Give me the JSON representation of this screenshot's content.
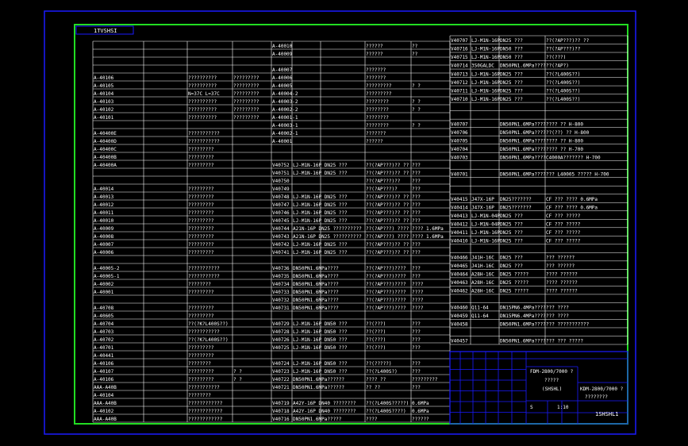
{
  "drawing": {
    "tag_top_left": "1TVSHSI",
    "tag_bottom_right": "1SHSHL1"
  },
  "title_block": {
    "line1": "FDM-2800/7000 ?",
    "line2": "?????",
    "line3": "(SHSHL)",
    "right1": "KDM-2800/7000 ?",
    "right2": "????????",
    "scale": "1:10",
    "sheet": "S"
  },
  "left_table": {
    "rows": [
      {
        "a": "",
        "b": "",
        "c": "",
        "d": "A-40010",
        "e": "",
        "f": "??????",
        "g": "??"
      },
      {
        "a": "",
        "b": "",
        "c": "",
        "d": "A-40009",
        "e": "",
        "f": "??????",
        "g": "??"
      },
      {
        "a": "",
        "b": "",
        "c": "",
        "d": "",
        "e": "",
        "f": "",
        "g": ""
      },
      {
        "a": "",
        "b": "",
        "c": "",
        "d": "A-40007",
        "e": "",
        "f": "???????",
        "g": ""
      },
      {
        "a": "A-40106",
        "b": "??????????",
        "c": "?????????",
        "d": "A-40006",
        "e": "",
        "f": "???????",
        "g": ""
      },
      {
        "a": "A-40105",
        "b": "??????????",
        "c": "?????????",
        "d": "A-40005",
        "e": "",
        "f": "?????????",
        "g": "?  ?"
      },
      {
        "a": "A-40104",
        "b": "N=37C  L=37C",
        "c": "?????????",
        "d": "A-40004-2",
        "e": "",
        "f": "?????????",
        "g": ""
      },
      {
        "a": "A-40103",
        "b": "??????????",
        "c": "?????????",
        "d": "A-40003-2",
        "e": "",
        "f": "????????",
        "g": "?  ?"
      },
      {
        "a": "A-40102",
        "b": "??????????",
        "c": "?????????",
        "d": "A-40002-2",
        "e": "",
        "f": "????????",
        "g": "?  ?"
      },
      {
        "a": "A-40101",
        "b": "??????????",
        "c": "?????????",
        "d": "A-40001-1",
        "e": "",
        "f": "????????",
        "g": ""
      },
      {
        "a": "",
        "b": "",
        "c": "",
        "d": "A-40003-1",
        "e": "",
        "f": "????????",
        "g": "?  ?"
      },
      {
        "a": "A-40400E",
        "b": "???????????",
        "c": "",
        "d": "A-40002-1",
        "e": "",
        "f": "???????",
        "g": ""
      },
      {
        "a": "A-40400D",
        "b": "???????????",
        "c": "",
        "d": "A-40001",
        "e": "",
        "f": "??????",
        "g": ""
      },
      {
        "a": "A-40400C",
        "b": "?????????",
        "c": "",
        "d": "",
        "e": "",
        "f": "",
        "g": ""
      },
      {
        "a": "A-40400B",
        "b": "?????????",
        "c": "",
        "d": "",
        "e": "",
        "f": "",
        "g": ""
      },
      {
        "a": "A-40400A",
        "b": "?????????",
        "c": "",
        "d": "V40752",
        "e": "LJ-M1N-16P  DN25 ???",
        "f": "??(?AP???)?? ??",
        "g": "???"
      },
      {
        "a": "",
        "b": "",
        "c": "",
        "d": "V40751",
        "e": "LJ-M1N-16P  DN25 ???",
        "f": "??(?AP???)?? ??",
        "g": "???"
      },
      {
        "a": "",
        "b": "",
        "c": "",
        "d": "V40750",
        "e": "",
        "f": "??(?AP???)??",
        "g": "???"
      },
      {
        "a": "A-40014",
        "b": "?????????",
        "c": "",
        "d": "V40749",
        "e": "",
        "f": "??(?AP???)?",
        "g": "???"
      },
      {
        "a": "A-40013",
        "b": "?????????",
        "c": "",
        "d": "V40748",
        "e": "LJ-M1N-16P  DN25 ???",
        "f": "??(?AP???)?? ??",
        "g": "???"
      },
      {
        "a": "A-40012",
        "b": "?????????",
        "c": "",
        "d": "V40747",
        "e": "LJ-M1N-16P  DN25 ???",
        "f": "??(?AP???)?? ??",
        "g": "???"
      },
      {
        "a": "A-40011",
        "b": "?????????",
        "c": "",
        "d": "V40746",
        "e": "LJ-M1N-16P  DN25 ???",
        "f": "??(?AP???)?? ??",
        "g": "???"
      },
      {
        "a": "A-40010",
        "b": "?????????",
        "c": "",
        "d": "V40745",
        "e": "LJ-M1N-16P  DN25 ???",
        "f": "??(?AP???)?? ??",
        "g": "???"
      },
      {
        "a": "A-40009",
        "b": "?????????",
        "c": "",
        "d": "V40744",
        "e": "A21N-16P  DN25 ??????????",
        "f": "??(?AP???) ????",
        "g": "????  1.6MPa"
      },
      {
        "a": "A-40008",
        "b": "?????????",
        "c": "",
        "d": "V40743",
        "e": "A21N-16P  DN25 ??????????",
        "f": "??(?AP???) ????",
        "g": "????  1.6MPa"
      },
      {
        "a": "A-40007",
        "b": "?????????",
        "c": "",
        "d": "V40742",
        "e": "LJ-M1N-16P  DN25 ???",
        "f": "??(?AP???)?? ??",
        "g": "???"
      },
      {
        "a": "A-40006",
        "b": "?????????",
        "c": "",
        "d": "V40741",
        "e": "LJ-M1N-16P  DN25 ???",
        "f": "??(?AP???)?? ??",
        "g": "???"
      },
      {
        "a": "",
        "b": "",
        "c": "",
        "d": "",
        "e": "",
        "f": "",
        "g": ""
      },
      {
        "a": "A-40005-2",
        "b": "???????????",
        "c": "",
        "d": "V40736",
        "e": "DN50PN1.6MPa????",
        "f": "??(?AP???)????",
        "g": "???"
      },
      {
        "a": "A-40005-1",
        "b": "???????????",
        "c": "",
        "d": "V40735",
        "e": "DN50PN1.6MPa????",
        "f": "??(?AP???)????",
        "g": "???"
      },
      {
        "a": "A-40002",
        "b": "????????",
        "c": "",
        "d": "V40734",
        "e": "DN50PN1.6MPa????",
        "f": "??(?AP???)????",
        "g": "????"
      },
      {
        "a": "A-40001",
        "b": "?????????",
        "c": "",
        "d": "V40733",
        "e": "DN50PN1.6MPa????",
        "f": "??(?AP???)????",
        "g": "????"
      },
      {
        "a": "",
        "b": "",
        "c": "",
        "d": "V40732",
        "e": "DN50PN1.6MPa????",
        "f": "??(?AP???)????",
        "g": "????"
      },
      {
        "a": "A-40708",
        "b": "?????????",
        "c": "",
        "d": "V40731",
        "e": "DN50PN1.6MPa????",
        "f": "??(?AP???)????",
        "g": "????"
      },
      {
        "a": "A-40605",
        "b": "?????????",
        "c": "",
        "d": "",
        "e": "",
        "f": "",
        "g": ""
      },
      {
        "a": "A-40704",
        "b": "??(?K?L400S??)",
        "c": "",
        "d": "V40729",
        "e": "LJ-M1N-16P  DN50 ???",
        "f": "??(???)",
        "g": "???"
      },
      {
        "a": "A-40703",
        "b": "???????????",
        "c": "",
        "d": "V40728",
        "e": "LJ-M1N-16P  DN50 ???",
        "f": "??(???)",
        "g": "???"
      },
      {
        "a": "A-40702",
        "b": "??(?K?L400S??)",
        "c": "",
        "d": "V40726",
        "e": "LJ-M1N-16P  DN50 ???",
        "f": "??(???)",
        "g": "???"
      },
      {
        "a": "A-40701",
        "b": "?????????",
        "c": "",
        "d": "V40725",
        "e": "LJ-M1N-16P  DN50 ???",
        "f": "??(???)",
        "g": "???"
      },
      {
        "a": "A-40441",
        "b": "?????????",
        "c": "",
        "d": "",
        "e": "",
        "f": "",
        "g": ""
      },
      {
        "a": "A-40106",
        "b": "????????",
        "c": "",
        "d": "V40724",
        "e": "LJ-M1N-16P  DN50 ???",
        "f": "??(?????)",
        "g": "???"
      },
      {
        "a": "A-40107",
        "b": "?????????",
        "c": "?  ?",
        "d": "V40723",
        "e": "LJ-M1N-16P  DN50 ???",
        "f": "??(?L400S?)",
        "g": "???"
      },
      {
        "a": "A-40106",
        "b": "?????????",
        "c": "?  ?",
        "d": "V40722",
        "e": "DN50PN1.6MPa??????",
        "f": "???? ??",
        "g": "?????????"
      },
      {
        "a": "AAA-A40B",
        "b": "???????????",
        "c": "",
        "d": "V40721",
        "e": "DN50PN1.6MPa??????",
        "f": "?? ??",
        "g": "???"
      },
      {
        "a": "A-40104",
        "b": "????????",
        "c": "",
        "d": "",
        "e": "",
        "f": "",
        "g": ""
      },
      {
        "a": "AAA-A40B",
        "b": "????????????",
        "c": "",
        "d": "V40719",
        "e": "A42Y-16P  DN40 ????????",
        "f": "??(?L400S?????)",
        "g": "0.6MPa"
      },
      {
        "a": "A-40102",
        "b": "????????????",
        "c": "",
        "d": "V40718",
        "e": "A42Y-16P  DN40 ????????",
        "f": "??(?L400S????)",
        "g": "0.6MPa"
      },
      {
        "a": "AAA-A40B",
        "b": "????????????",
        "c": "",
        "d": "V40716",
        "e": "DN50PN1.6MPa?????",
        "f": "????",
        "g": "??????"
      }
    ]
  },
  "right_table": {
    "rows": [
      {
        "a": "V40707",
        "b": "LJ-M1N-16P",
        "c": "DN25 ???",
        "d": "??(?AP???)?? ??"
      },
      {
        "a": "V40716",
        "b": "LJ-M1N-16P",
        "c": "DN50 ???",
        "d": "??(?AP???)??"
      },
      {
        "a": "V40715",
        "b": "LJ-M1N-16P",
        "c": "DN50 ???",
        "d": "??(???)"
      },
      {
        "a": "V40714",
        "b": "3S0GALDC",
        "c": "DN50PN1.6MPa????",
        "d": "??(?AP?)"
      },
      {
        "a": "V40713",
        "b": "LJ-M1N-16P",
        "c": "DN25 ???",
        "d": "??(?L400S??)"
      },
      {
        "a": "V40712",
        "b": "LJ-M1N-16P",
        "c": "DN25 ???",
        "d": "??(?L400S??)"
      },
      {
        "a": "V40711",
        "b": "LJ-M1N-16P",
        "c": "DN25 ???",
        "d": "??(?L400S??)"
      },
      {
        "a": "V40710",
        "b": "LJ-M1N-16P",
        "c": "DN25 ???",
        "d": "??(?L400S??)"
      },
      {
        "a": "",
        "b": "",
        "c": "",
        "d": ""
      },
      {
        "a": "",
        "b": "",
        "c": "",
        "d": ""
      },
      {
        "a": "V40707",
        "b": "",
        "c": "DN50PN1.6MPa????",
        "d": "????  ??  H-800"
      },
      {
        "a": "V40706",
        "b": "",
        "c": "DN50PN1.6MPa????",
        "d": "??(??)  ??  H-800"
      },
      {
        "a": "V40705",
        "b": "",
        "c": "DN50PN1.6MPa????",
        "d": "????  ??  H-800"
      },
      {
        "a": "V40704",
        "b": "",
        "c": "DN50PN1.6MPa????",
        "d": "????  ??  H-700"
      },
      {
        "a": "V40703",
        "b": "",
        "c": "DN50PN1.6MPa????",
        "d": "C4000A???????  H-700"
      },
      {
        "a": "",
        "b": "",
        "c": "",
        "d": ""
      },
      {
        "a": "V40701",
        "b": "",
        "c": "DN50PN1.6MPa????",
        "d": "??? L40005  ?????  H-700"
      },
      {
        "a": "",
        "b": "",
        "c": "",
        "d": ""
      },
      {
        "a": "",
        "b": "",
        "c": "",
        "d": ""
      },
      {
        "a": "V40415",
        "b": "J47X-16P",
        "c": "DN25???????",
        "d": "CF ??? ???? 0.6MPa"
      },
      {
        "a": "V40414",
        "b": "J47X-16P",
        "c": "DN25???????",
        "d": "CF ??? ???? 0.6MPa"
      },
      {
        "a": "V40413",
        "b": "LJ-M1N-04P",
        "c": "DN25 ???",
        "d": "CF ??? ?????"
      },
      {
        "a": "V40412",
        "b": "LJ-M1N-04P",
        "c": "DN25 ???",
        "d": "CF ??? ?????"
      },
      {
        "a": "V40411",
        "b": "LJ-M1N-16P",
        "c": "DN25 ???",
        "d": "CF ??? ?????"
      },
      {
        "a": "V40410",
        "b": "LJ-M1N-16P",
        "c": "DN25 ???",
        "d": "CF ??? ?????"
      },
      {
        "a": "",
        "b": "",
        "c": "",
        "d": ""
      },
      {
        "a": "V40466",
        "b": "J41H-16C",
        "c": "DN25 ???",
        "d": "???  ??????"
      },
      {
        "a": "V40465",
        "b": "J41H-16C",
        "c": "DN25 ???",
        "d": "???  ??????"
      },
      {
        "a": "V40464",
        "b": "A28H-16C",
        "c": "DN25 ?????",
        "d": "????  ??????"
      },
      {
        "a": "V40463",
        "b": "A28H-16C",
        "c": "DN25 ?????",
        "d": "????  ??????"
      },
      {
        "a": "V40462",
        "b": "A28H-16C",
        "c": "DN25 ?????",
        "d": "????  ??????"
      },
      {
        "a": "",
        "b": "",
        "c": "",
        "d": ""
      },
      {
        "a": "V40460",
        "b": "Q11-64",
        "c": "DN15PN6.4MPa????",
        "d": "???  ????"
      },
      {
        "a": "V40459",
        "b": "Q11-64",
        "c": "DN15PN6.4MPa????",
        "d": "???  ????"
      },
      {
        "a": "V40458",
        "b": "",
        "c": "DN50PN1.6MPa????",
        "d": "???  ???????????"
      },
      {
        "a": "",
        "b": "",
        "c": "",
        "d": ""
      },
      {
        "a": "V40457",
        "b": "",
        "c": "DN50PN1.6MPa????",
        "d": "???  ???  ?????"
      }
    ]
  }
}
